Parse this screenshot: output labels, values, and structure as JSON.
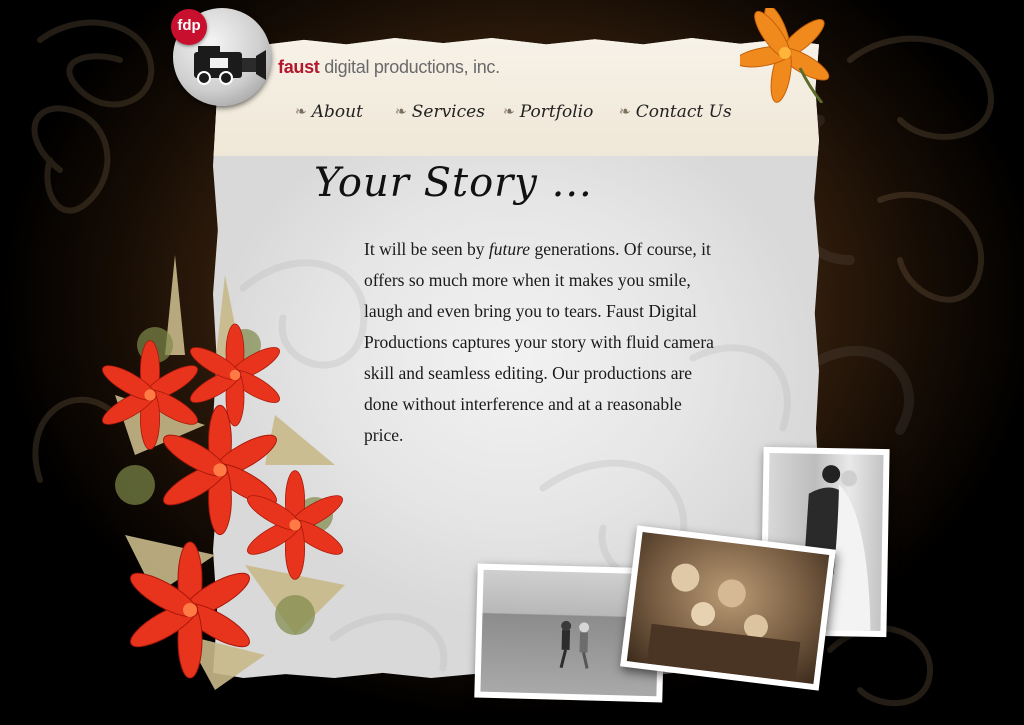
{
  "brand": {
    "badge": "fdp",
    "name_highlight": "faust",
    "name_rest": " digital productions, inc."
  },
  "nav": {
    "items": [
      {
        "label": "About"
      },
      {
        "label": "Services"
      },
      {
        "label": "Portfolio"
      },
      {
        "label": "Contact Us"
      }
    ]
  },
  "content": {
    "headline": "Your Story ...",
    "body_before": "It will be seen by ",
    "body_emphasis": "future",
    "body_after": " generations. Of course, it offers so much more when it makes you smile, laugh and even bring you to tears. Faust Digital Productions captures your story with fluid camera skill and seamless editing. Our productions are done without interference and at a reasonable price."
  },
  "colors": {
    "brand_red": "#b2182b",
    "lily_red": "#e8341c",
    "lily_orange": "#f08a1c",
    "background_brown": "#3d2510"
  },
  "icons": {
    "nav_bullet": "swirl-icon",
    "logo": "video-camera-icon"
  }
}
